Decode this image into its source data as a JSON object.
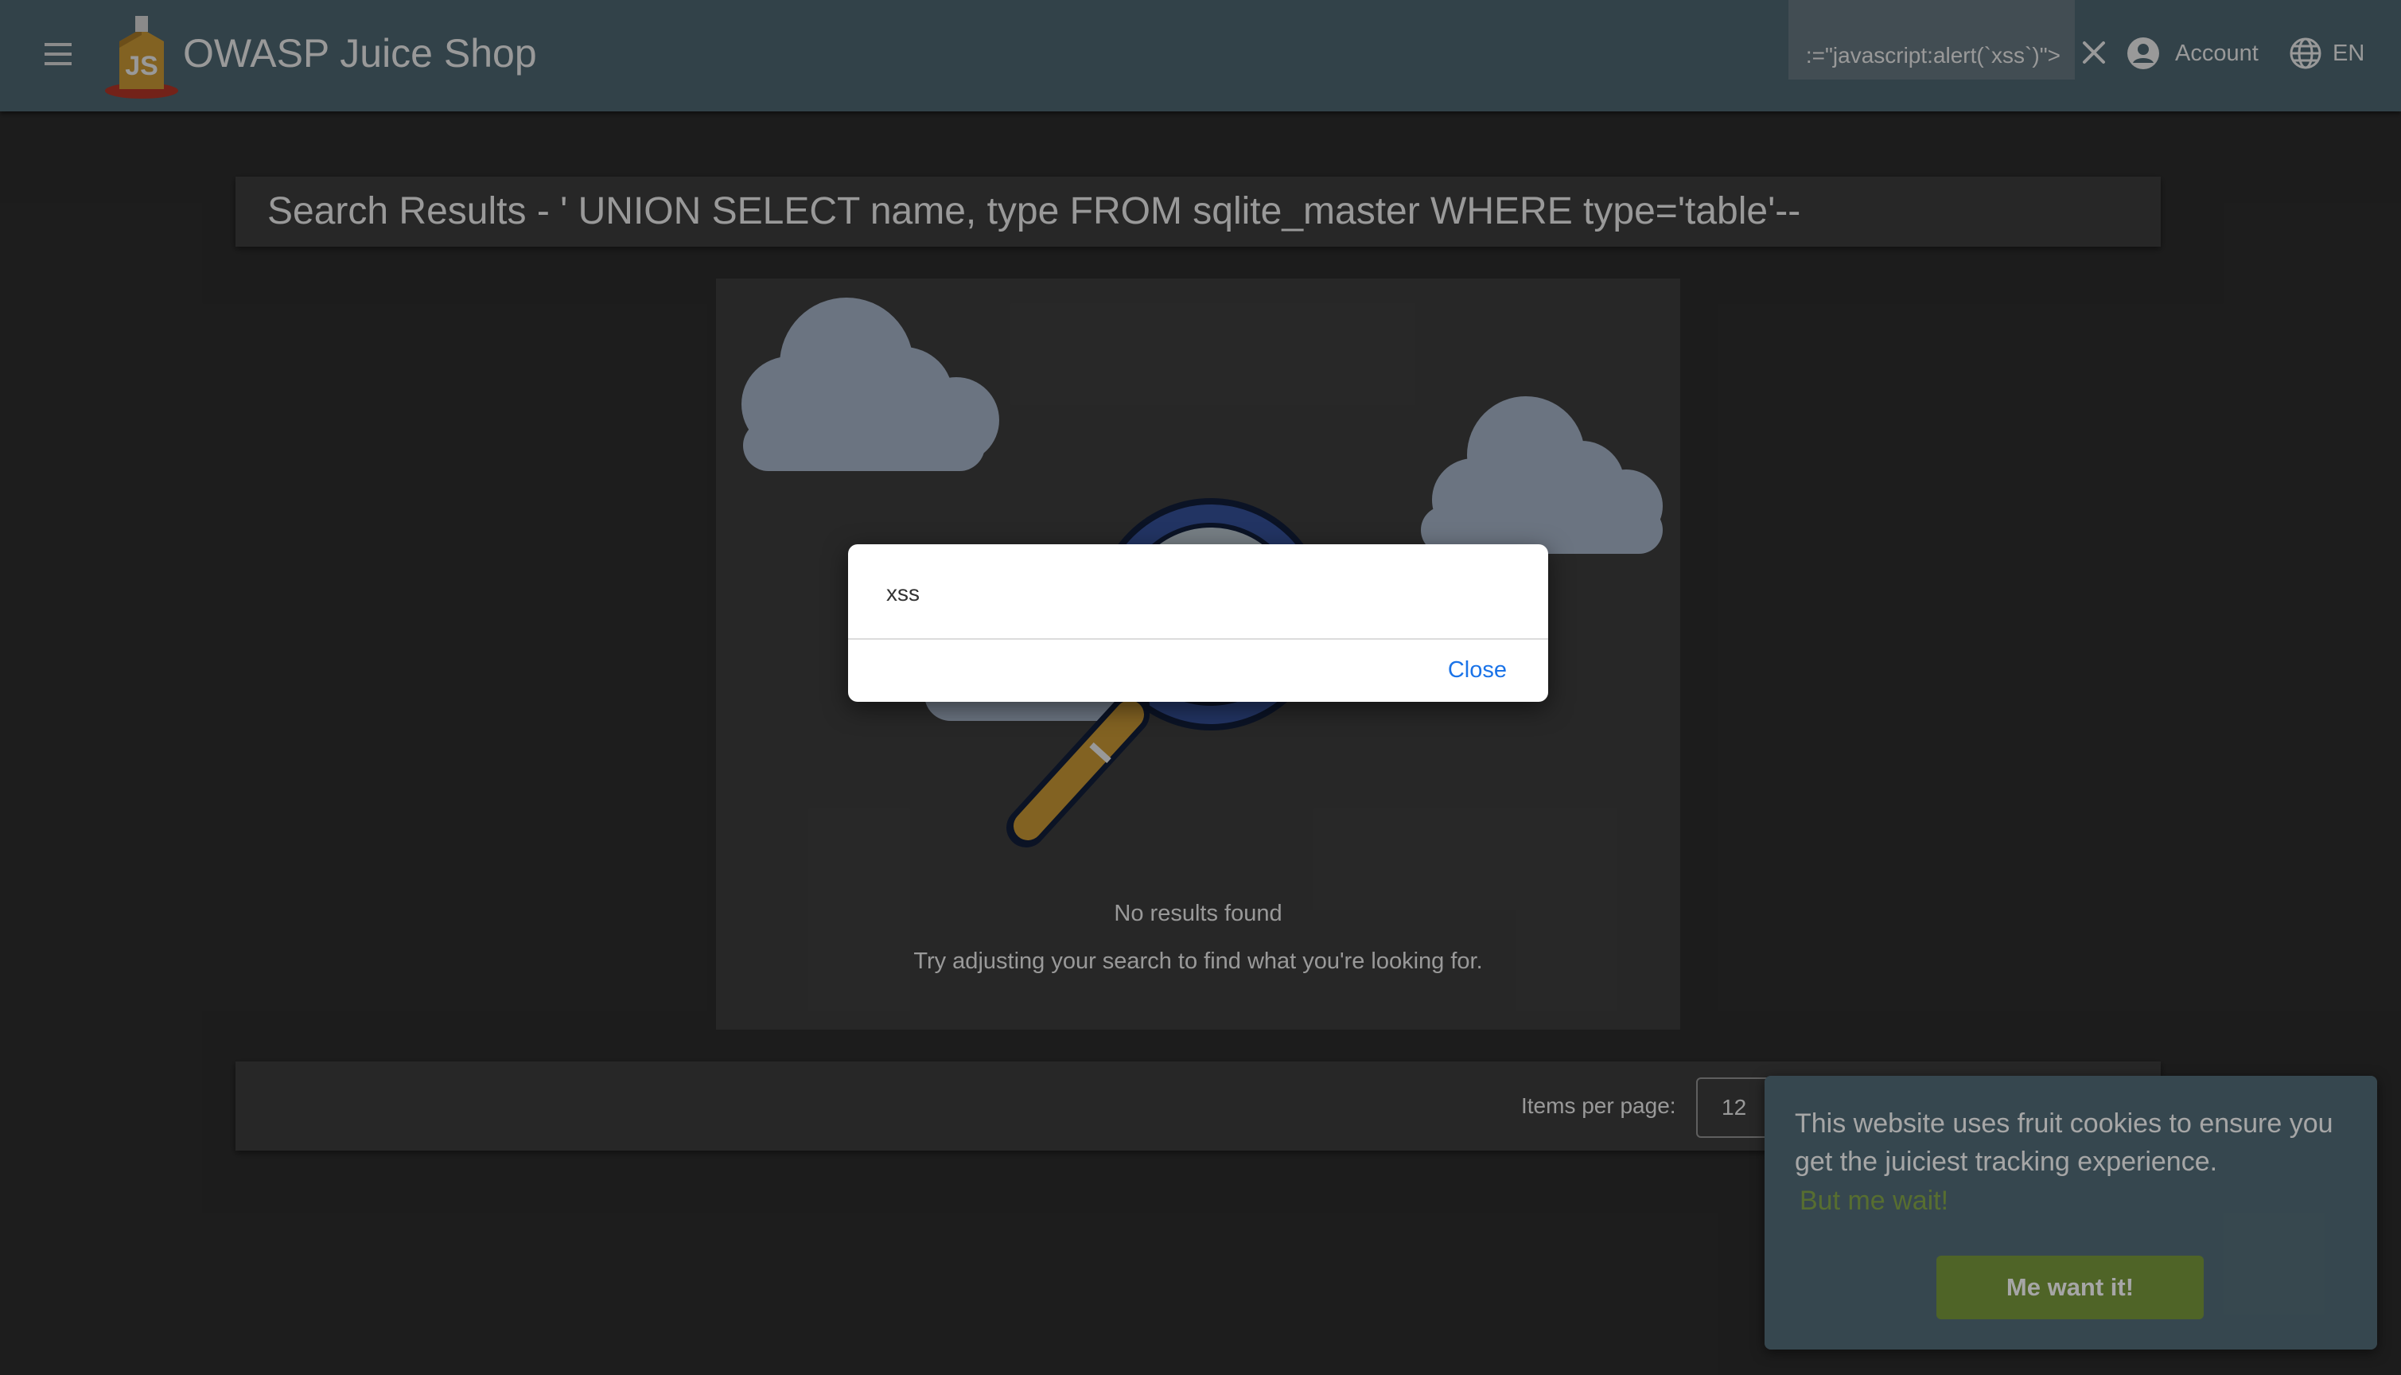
{
  "header": {
    "app_title": "OWASP Juice Shop",
    "search_value": ":=\"javascript:alert(`xss`)\">",
    "account_label": "Account",
    "language_label": "EN"
  },
  "results": {
    "title": "Search Results - ' UNION SELECT name, type FROM sqlite_master WHERE type='table'--",
    "no_results": "No results found",
    "hint": "Try adjusting your search to find what you're looking for."
  },
  "paginator": {
    "items_per_page_label": "Items per page:",
    "items_per_page_value": "12"
  },
  "alert_dialog": {
    "message": "xss",
    "close_label": "Close"
  },
  "cookie_banner": {
    "message": "This website uses fruit cookies to ensure you get the juiciest tracking experience.",
    "learn_more": "But me wait!",
    "accept": "Me want it!"
  },
  "colors": {
    "toolbar": "#546e7a",
    "background": "#303030",
    "card": "#424242",
    "accent_green": "#7a9a3c",
    "link_blue": "#1a73e8",
    "cloud": "#b3c2d8"
  },
  "icons": [
    "menu-icon",
    "juice-shop-logo",
    "close-icon",
    "account-circle-icon",
    "language-icon",
    "cloud-icon",
    "magnifier-icon"
  ]
}
